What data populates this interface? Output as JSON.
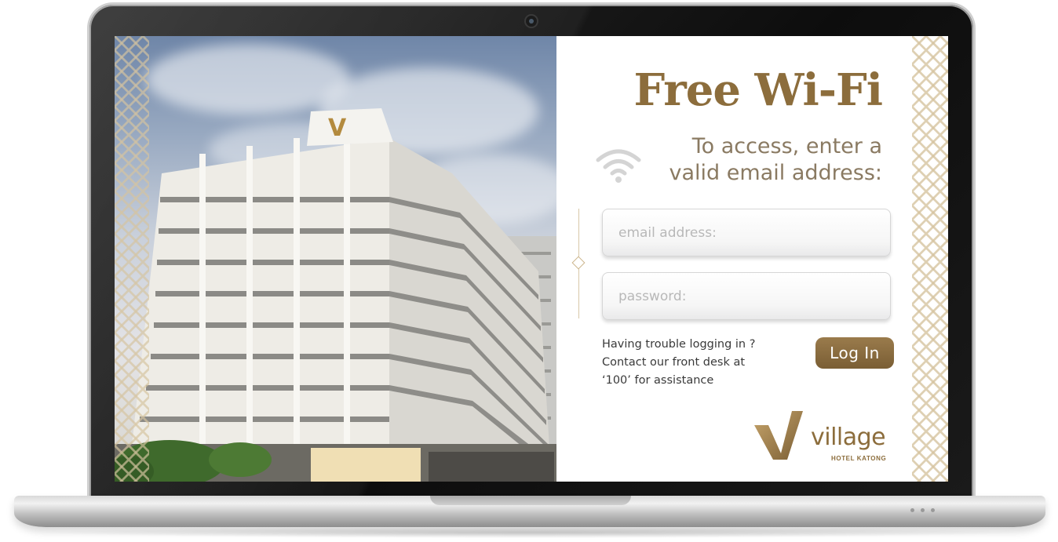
{
  "login": {
    "title": "Free Wi-Fi",
    "subtitle_line1": "To access, enter a",
    "subtitle_line2": "valid email address:",
    "email_placeholder": "email address:",
    "password_placeholder": "password:",
    "help_line1": "Having trouble logging in ?",
    "help_line2": "Contact our front desk at",
    "help_line3": "‘100’ for assistance",
    "login_label": "Log In"
  },
  "brand": {
    "name": "village",
    "subtitle": "HOTEL KATONG",
    "accent_color": "#8c6d3c"
  },
  "icons": [
    "wifi-icon",
    "village-logo-icon",
    "webcam-icon"
  ]
}
